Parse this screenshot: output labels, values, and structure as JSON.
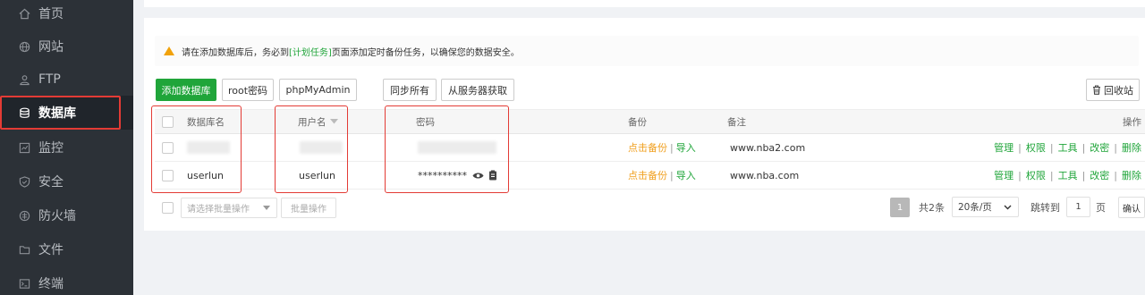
{
  "sidebar": {
    "items": [
      {
        "label": "首页",
        "icon": "home-icon"
      },
      {
        "label": "网站",
        "icon": "globe-icon"
      },
      {
        "label": "FTP",
        "icon": "ftp-icon"
      },
      {
        "label": "数据库",
        "icon": "database-icon"
      },
      {
        "label": "监控",
        "icon": "monitor-icon"
      },
      {
        "label": "安全",
        "icon": "shield-icon"
      },
      {
        "label": "防火墙",
        "icon": "firewall-icon"
      },
      {
        "label": "文件",
        "icon": "folder-icon"
      },
      {
        "label": "终端",
        "icon": "terminal-icon"
      }
    ],
    "active_index": 3
  },
  "notice": {
    "prefix": "请在添加数据库后，务必到",
    "link": "[计划任务]",
    "suffix": "页面添加定时备份任务，以确保您的数据安全。"
  },
  "toolbar": {
    "add_db": "添加数据库",
    "root_pwd": "root密码",
    "phpmyadmin": "phpMyAdmin",
    "sync_all": "同步所有",
    "fetch_server": "从服务器获取",
    "recycle": "回收站"
  },
  "table": {
    "headers": {
      "name": "数据库名",
      "user": "用户名",
      "password": "密码",
      "backup": "备份",
      "remark": "备注",
      "ops": "操作"
    },
    "rows": [
      {
        "name": "",
        "user": "",
        "password": "",
        "backup_link": "点击备份",
        "import_link": "导入",
        "remark": "www.nba2.com"
      },
      {
        "name": "userlun",
        "user": "userlun",
        "password": "**********",
        "backup_link": "点击备份",
        "import_link": "导入",
        "remark": "www.nba.com"
      }
    ],
    "ops": [
      "管理",
      "权限",
      "工具",
      "改密",
      "删除"
    ]
  },
  "footer": {
    "batch_placeholder": "请选择批量操作",
    "batch_button": "批量操作",
    "page_current": "1",
    "total": "共2条",
    "per_page": "20条/页",
    "jump_label": "跳转到",
    "jump_value": "1",
    "page_unit": "页",
    "confirm": "确认"
  },
  "colors": {
    "accent": "#20a53a",
    "warning": "#f0a020",
    "highlight": "#e33b35",
    "sidebar_bg": "#2c3137"
  }
}
